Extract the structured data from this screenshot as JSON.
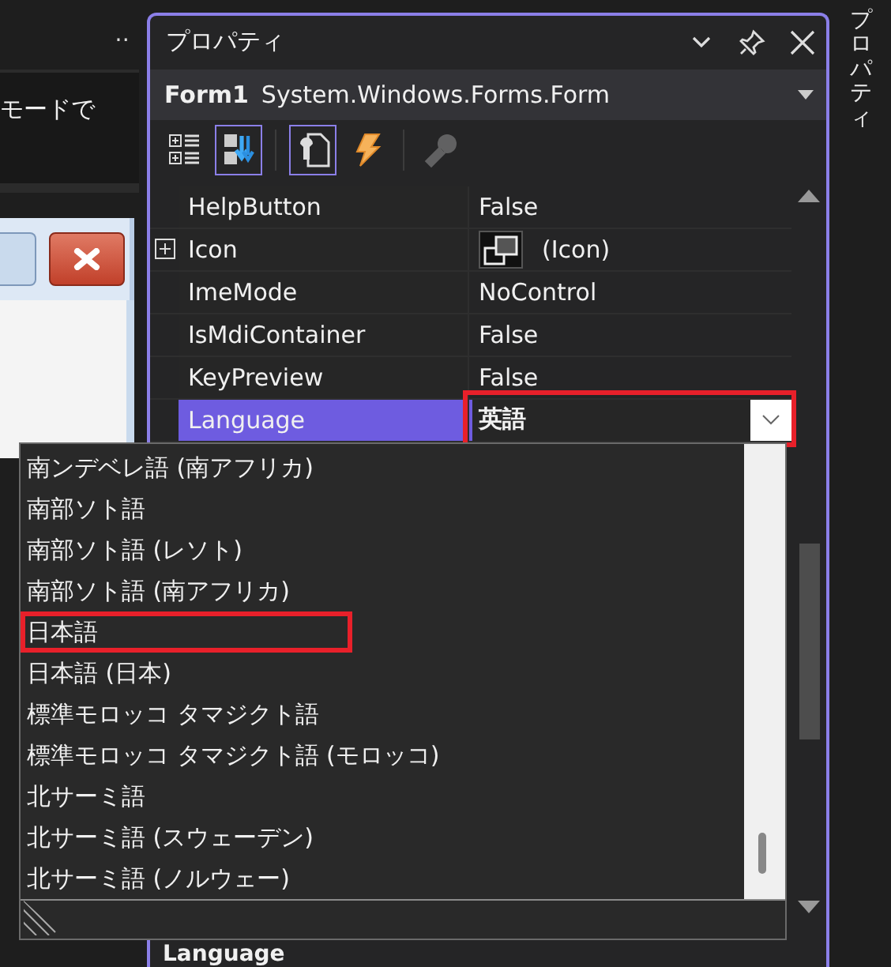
{
  "left_pane": {
    "more": "‥",
    "text": "モードで"
  },
  "panel": {
    "title": "プロパティ",
    "object": {
      "name": "Form1",
      "type": "System.Windows.Forms.Form"
    },
    "toolbar": [
      {
        "kind": "categorized",
        "selected": false,
        "disabled": false
      },
      {
        "kind": "alphabetical",
        "selected": true,
        "disabled": false
      },
      {
        "kind": "properties",
        "selected": true,
        "disabled": false
      },
      {
        "kind": "events",
        "selected": false,
        "disabled": false
      },
      {
        "kind": "property_pages",
        "selected": false,
        "disabled": true
      }
    ],
    "properties": [
      {
        "name": "HelpButton",
        "value": "False",
        "kind": "text",
        "expandable": false,
        "selected": false,
        "modified": false,
        "highlighted": false
      },
      {
        "name": "Icon",
        "value": "(Icon)",
        "kind": "icon",
        "expandable": true,
        "selected": false,
        "modified": false,
        "highlighted": false
      },
      {
        "name": "ImeMode",
        "value": "NoControl",
        "kind": "text",
        "expandable": false,
        "selected": false,
        "modified": false,
        "highlighted": false
      },
      {
        "name": "IsMdiContainer",
        "value": "False",
        "kind": "text",
        "expandable": false,
        "selected": false,
        "modified": false,
        "highlighted": false
      },
      {
        "name": "KeyPreview",
        "value": "False",
        "kind": "text",
        "expandable": false,
        "selected": false,
        "modified": false,
        "highlighted": false
      },
      {
        "name": "Language",
        "value": "英語",
        "kind": "dropdown",
        "expandable": false,
        "selected": true,
        "modified": true,
        "highlighted": true
      }
    ],
    "description": {
      "title": "Language"
    }
  },
  "dropdown": {
    "items": [
      {
        "label": "南ンデベレ語 (南アフリカ)",
        "highlighted": false
      },
      {
        "label": "南部ソト語",
        "highlighted": false
      },
      {
        "label": "南部ソト語 (レソト)",
        "highlighted": false
      },
      {
        "label": "南部ソト語 (南アフリカ)",
        "highlighted": false
      },
      {
        "label": "日本語",
        "highlighted": true
      },
      {
        "label": "日本語 (日本)",
        "highlighted": false
      },
      {
        "label": "標準モロッコ タマジクト語",
        "highlighted": false
      },
      {
        "label": "標準モロッコ タマジクト語 (モロッコ)",
        "highlighted": false
      },
      {
        "label": "北サーミ語",
        "highlighted": false
      },
      {
        "label": "北サーミ語 (スウェーデン)",
        "highlighted": false
      },
      {
        "label": "北サーミ語 (ノルウェー)",
        "highlighted": false
      }
    ]
  },
  "side_tab": {
    "label": "プロパティ"
  }
}
